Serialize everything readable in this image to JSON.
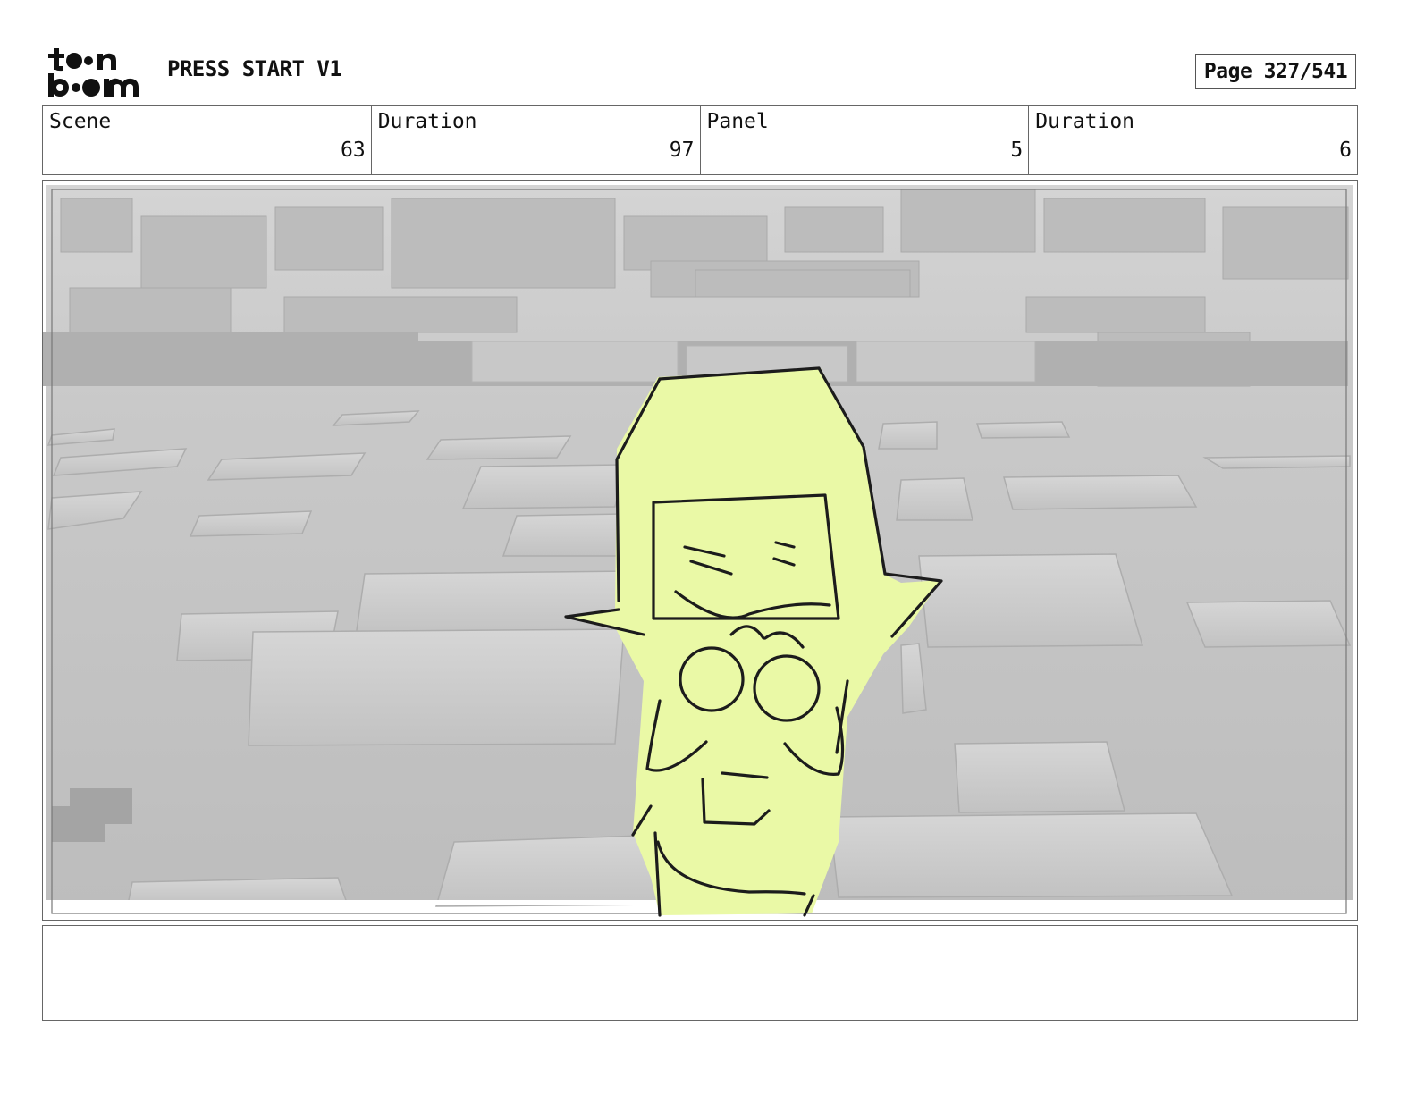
{
  "header": {
    "logo_text_top": "toon",
    "logo_text_bottom": "boom",
    "project_title": "PRESS START V1",
    "page_label": "Page 327/541"
  },
  "info": {
    "scene_label": "Scene",
    "scene_value": "63",
    "scene_duration_label": "Duration",
    "scene_duration_value": "97",
    "panel_label": "Panel",
    "panel_value": "5",
    "panel_duration_label": "Duration",
    "panel_duration_value": "6"
  },
  "panel": {
    "image_description_icon": "storyboard-sketch",
    "character_color": "#eaf9a6",
    "background_color": "#c8c8c8"
  },
  "notes": {
    "text": ""
  }
}
